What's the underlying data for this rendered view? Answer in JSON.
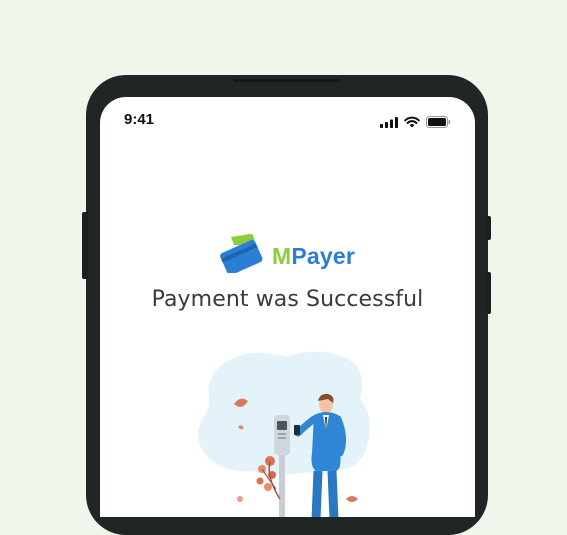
{
  "status_bar": {
    "time": "9:41",
    "icons": [
      "cellular-signal-icon",
      "wifi-icon",
      "battery-icon"
    ]
  },
  "brand": {
    "logo_icon": "wallet-card-icon",
    "name_part_1": "M",
    "name_part_2": "Payer",
    "colors": {
      "green": "#8ccd3d",
      "blue": "#2a7fd4"
    }
  },
  "main": {
    "title": "Payment was Successful",
    "illustration": "man-paying-at-card-terminal-illustration"
  },
  "colors": {
    "background": "#f1f6ec",
    "phone_frame": "#1f2624",
    "screen": "#ffffff",
    "heading_text": "#3a3a3a"
  }
}
